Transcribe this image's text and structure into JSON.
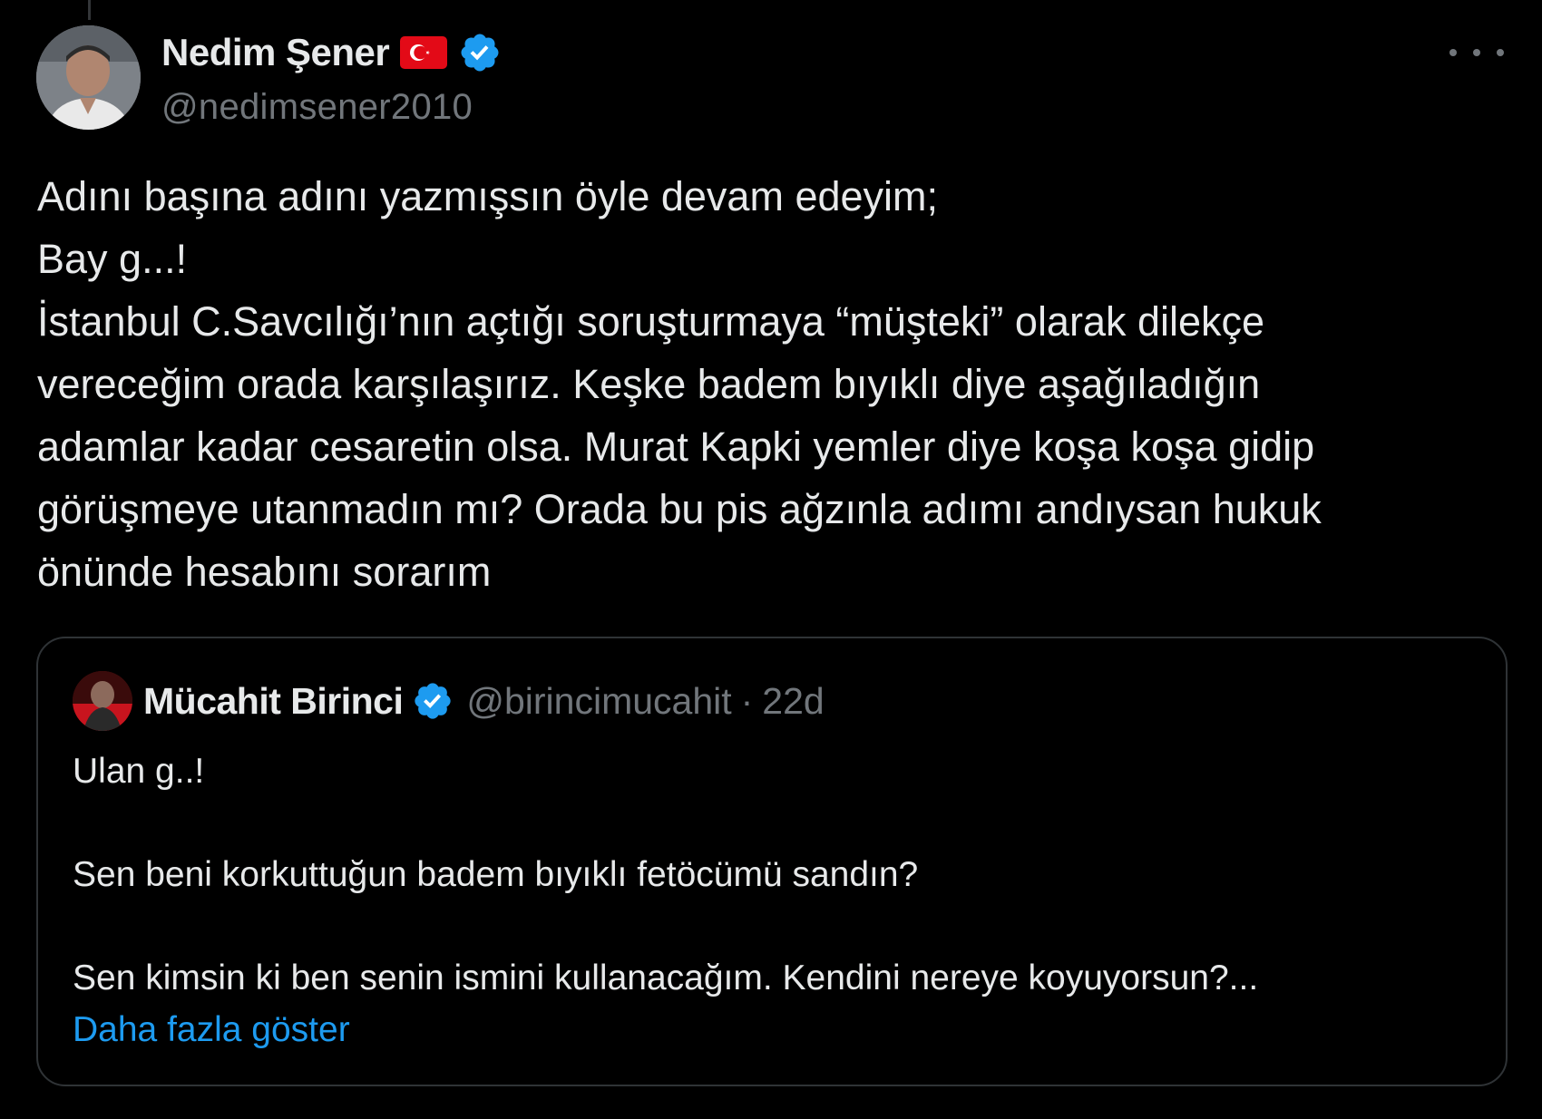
{
  "tweet": {
    "author": {
      "display_name": "Nedim Şener",
      "handle": "@nedimsener2010",
      "flag_icon": "turkey-flag-icon",
      "verified_icon": "verified-badge-icon"
    },
    "more_icon": "more-options-icon",
    "text_lines": [
      "Adını başına adını yazmışsın öyle devam edeyim;",
      "Bay g...!",
      "İstanbul C.Savcılığı’nın açtığı soruşturmaya “müşteki” olarak dilekçe",
      "vereceğim orada karşılaşırız. Keşke badem bıyıklı diye aşağıladığın",
      "adamlar kadar cesaretin olsa. Murat Kapki yemler diye koşa koşa gidip",
      "görüşmeye utanmadın mı? Orada bu pis ağzınla adımı andıysan hukuk",
      "önünde hesabını sorarım"
    ]
  },
  "quote": {
    "author": {
      "display_name": "Mücahit Birinci",
      "handle": "@birincimucahit",
      "separator": "·",
      "time": "22d"
    },
    "lines": [
      "Ulan g..!",
      "Sen beni korkuttuğun badem bıyıklı fetöcümü sandın?",
      "Sen kimsin ki ben senin ismini kullanacağım. Kendini nereye koyuyorsun?..."
    ],
    "show_more": "Daha fazla göster"
  },
  "colors": {
    "background": "#000000",
    "text": "#e7e9ea",
    "secondary": "#71767b",
    "accent": "#1d9bf0",
    "border": "#2f3336",
    "flag_red": "#e30a17"
  }
}
